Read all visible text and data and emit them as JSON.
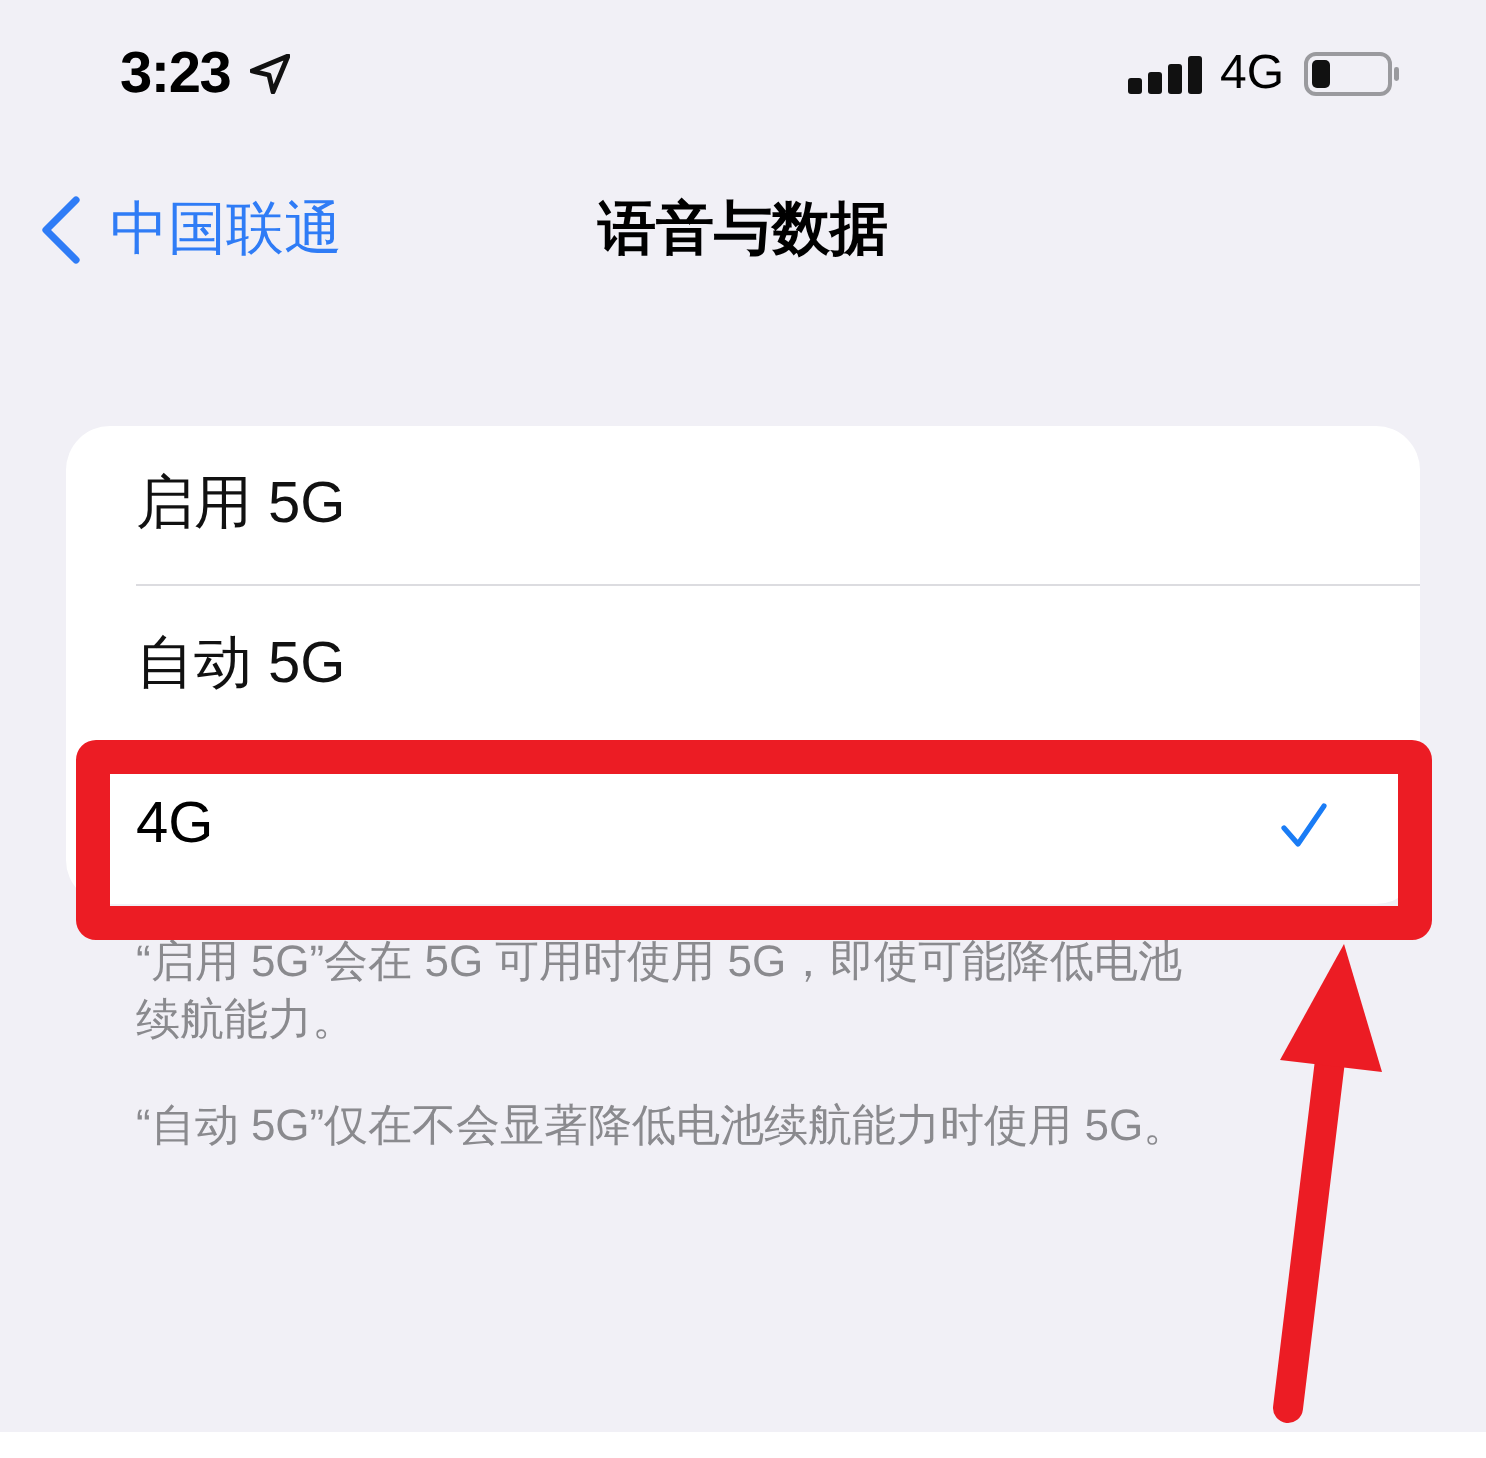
{
  "status_bar": {
    "time": "3:23",
    "network": "4G"
  },
  "nav": {
    "back": "中国联通",
    "title": "语音与数据"
  },
  "options": [
    {
      "label": "启用 5G",
      "selected": false
    },
    {
      "label": "自动 5G",
      "selected": false
    },
    {
      "label": "4G",
      "selected": true
    }
  ],
  "footer": [
    "“启用 5G”会在 5G 可用时使用 5G，即使可能降低电池续航能力。",
    "“自动 5G”仅在不会显著降低电池续航能力时使用 5G。"
  ]
}
